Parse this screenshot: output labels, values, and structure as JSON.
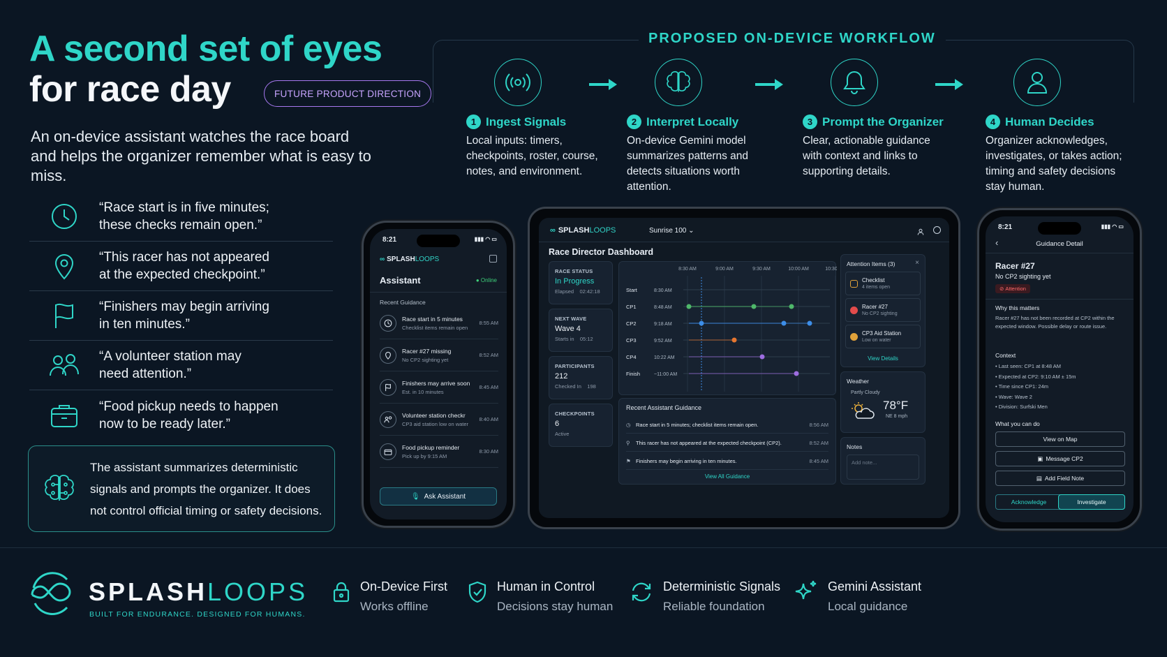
{
  "hero": {
    "title_line1": "A second set of eyes",
    "title_line2": "for race day",
    "badge": "FUTURE PRODUCT DIRECTION",
    "intro": "An on-device assistant watches the race board and helps the organizer remember what is easy to miss.",
    "quotes": [
      {
        "icon": "clock-icon",
        "line1": "“Race start is in five minutes;",
        "line2": "these checks remain open.”"
      },
      {
        "icon": "map-pin-icon",
        "line1": "“This racer has not appeared",
        "line2": "at the expected checkpoint.”"
      },
      {
        "icon": "flag-icon",
        "line1": "“Finishers may begin arriving",
        "line2": "in ten minutes.”"
      },
      {
        "icon": "people-icon",
        "line1": "“A volunteer station may",
        "line2": "need attention.”"
      },
      {
        "icon": "food-box-icon",
        "line1": "“Food pickup needs to happen",
        "line2": "now to be ready later.”"
      }
    ],
    "note": "The assistant summarizes deterministic signals and prompts the organizer. It does not control official timing or safety decisions."
  },
  "workflow": {
    "title": "PROPOSED ON-DEVICE WORKFLOW",
    "steps": [
      {
        "num": "1",
        "icon": "broadcast-icon",
        "title": "Ingest Signals",
        "desc": "Local inputs: timers, checkpoints, roster, course, notes, and environment."
      },
      {
        "num": "2",
        "icon": "brain-icon",
        "title": "Interpret Locally",
        "desc": "On-device Gemini model summarizes patterns and detects situations worth attention."
      },
      {
        "num": "3",
        "icon": "bell-icon",
        "title": "Prompt the Organizer",
        "desc": "Clear, actionable guidance with context and links to supporting details."
      },
      {
        "num": "4",
        "icon": "person-icon",
        "title": "Human Decides",
        "desc": "Organizer acknowledges, investigates, or takes action; timing and safety decisions stay human."
      }
    ]
  },
  "phone_left": {
    "time": "8:21",
    "brand_a": "SPLASH",
    "brand_b": "LOOPS",
    "title": "Assistant",
    "status": "Online",
    "section": "Recent Guidance",
    "items": [
      {
        "icon": "clock-icon",
        "title": "Race start in 5 minutes",
        "sub": "Checklist items remain open",
        "time": "8:55 AM"
      },
      {
        "icon": "map-pin-icon",
        "title": "Racer #27 missing",
        "sub": "No CP2 sighting yet",
        "time": "8:52 AM"
      },
      {
        "icon": "flag-icon",
        "title": "Finishers may arrive soon",
        "sub": "Est. in 10 minutes",
        "time": "8:45 AM"
      },
      {
        "icon": "people-icon",
        "title": "Volunteer station checkr",
        "sub": "CP3 aid station low on water",
        "time": "8:40 AM"
      },
      {
        "icon": "food-box-icon",
        "title": "Food pickup reminder",
        "sub": "Pick up by 9:15 AM",
        "time": "8:30 AM"
      }
    ],
    "button": "Ask Assistant"
  },
  "tablet": {
    "brand_a": "SPLASH",
    "brand_b": "LOOPS",
    "event": "Sunrise 100",
    "title": "Race Director Dashboard",
    "stats": [
      {
        "label": "RACE STATUS",
        "value": "In Progress",
        "sub_label": "Elapsed",
        "sub_value": "02:42:18"
      },
      {
        "label": "NEXT WAVE",
        "value": "Wave 4",
        "sub_label": "Starts in",
        "sub_value": "05:12"
      },
      {
        "label": "PARTICIPANTS",
        "value": "212",
        "sub_label": "Checked In",
        "sub_value": "198"
      },
      {
        "label": "CHECKPOINTS",
        "value": "6",
        "sub_label": "Active",
        "sub_value": ""
      }
    ],
    "timeline": {
      "ticks": [
        "8:30 AM",
        "9:00 AM",
        "9:30 AM",
        "10:00 AM",
        "10:30 AM"
      ],
      "rows": [
        {
          "label": "Start",
          "time": "8:30 AM"
        },
        {
          "label": "CP1",
          "time": "8:48 AM"
        },
        {
          "label": "CP2",
          "time": "9:18 AM"
        },
        {
          "label": "CP3",
          "time": "9:52 AM"
        },
        {
          "label": "CP4",
          "time": "10:22 AM"
        },
        {
          "label": "Finish",
          "time": "~11:00 AM"
        }
      ]
    },
    "guidance_title": "Recent Assistant Guidance",
    "guidance": [
      {
        "icon": "clock-icon",
        "text": "Race start in 5 minutes; checklist items remain open.",
        "time": "8:56 AM"
      },
      {
        "icon": "map-pin-icon",
        "text": "This racer has not appeared at the expected checkpoint (CP2).",
        "time": "8:52 AM"
      },
      {
        "icon": "flag-icon",
        "text": "Finishers may begin arriving in ten minutes.",
        "time": "8:45 AM"
      }
    ],
    "guidance_link": "View All Guidance",
    "attention_title": "Attention Items (3)",
    "attention": [
      {
        "title": "Checklist",
        "sub": "4 items open",
        "color": "#e0a23a"
      },
      {
        "title": "Racer #27",
        "sub": "No CP2 sighting",
        "color": "#e24b4b"
      },
      {
        "title": "CP3 Aid Station",
        "sub": "Low on water",
        "color": "#e0a23a"
      }
    ],
    "attention_link": "View Details",
    "weather_title": "Weather",
    "weather_cond": "Partly Cloudy",
    "weather_temp": "78°F",
    "weather_wind": "NE 8 mph",
    "notes_title": "Notes",
    "notes_placeholder": "Add note..."
  },
  "phone_right": {
    "time": "8:21",
    "header": "Guidance Detail",
    "racer": "Racer #27",
    "racer_sub": "No CP2 sighting yet",
    "badge": "Attention",
    "why_title": "Why this matters",
    "why_text": "Racer #27 has not been recorded at CP2 within the expected window. Possible delay or route issue.",
    "context_title": "Context",
    "context": [
      "Last seen: CP1 at 8:48 AM",
      "Expected at CP2: 9:10 AM ± 15m",
      "Time since CP1: 24m",
      "Wave: Wave 2",
      "Division: Surfski Men"
    ],
    "actions_title": "What you can do",
    "actions": [
      "View on Map",
      "Message CP2",
      "Add Field Note"
    ],
    "ack": "Acknowledge",
    "investigate": "Investigate"
  },
  "footer": {
    "brand_a": "SPLASH",
    "brand_b": "LOOPS",
    "tagline": "BUILT FOR ENDURANCE. DESIGNED FOR HUMANS.",
    "features": [
      {
        "icon": "lock-icon",
        "title": "On-Device First",
        "sub": "Works offline"
      },
      {
        "icon": "shield-check-icon",
        "title": "Human in Control",
        "sub": "Decisions stay human"
      },
      {
        "icon": "sync-icon",
        "title": "Deterministic Signals",
        "sub": "Reliable foundation"
      },
      {
        "icon": "sparkle-icon",
        "title": "Gemini Assistant",
        "sub": "Local guidance"
      }
    ]
  },
  "colors": {
    "accent": "#2fd6c8",
    "purple": "#a678ef",
    "background": "#0b1623"
  }
}
